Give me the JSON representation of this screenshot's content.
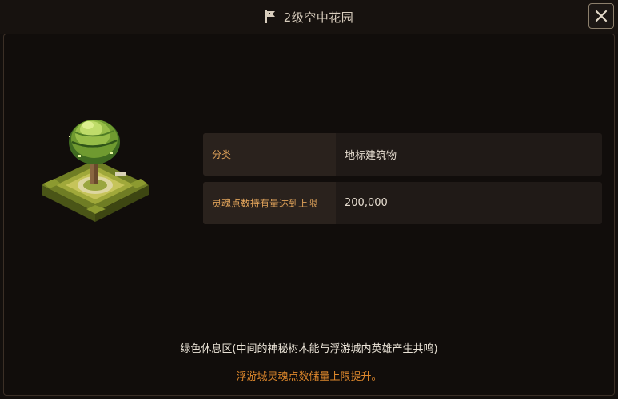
{
  "title": {
    "icon": "flag-icon",
    "text": "2级空中花园"
  },
  "close_button": {
    "icon": "close-icon"
  },
  "building": {
    "image": "sky-garden-tree-building"
  },
  "info_rows": [
    {
      "label": "分类",
      "value": "地标建筑物"
    },
    {
      "label": "灵魂点数持有量达到上限",
      "value": "200,000"
    }
  ],
  "description": "绿色休息区(中间的神秘树木能与浮游城内英雄产生共鸣)",
  "effect": "浮游城灵魂点数储量上限提升。",
  "colors": {
    "label": "#e0a35a",
    "effect": "#e0892c",
    "background": "#130f0d"
  }
}
